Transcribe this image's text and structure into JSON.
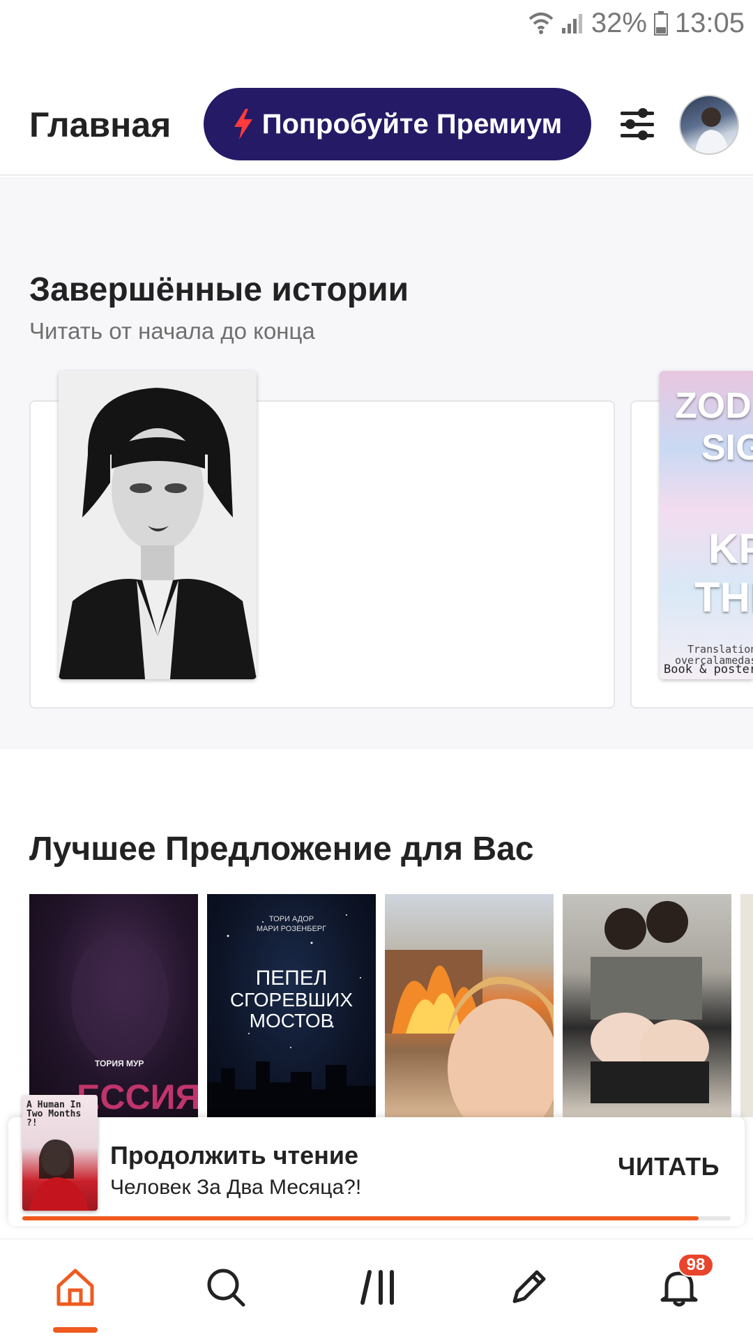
{
  "status_bar": {
    "battery": "32%",
    "time": "13:05"
  },
  "header": {
    "title": "Главная",
    "premium_label": "Попробуйте Премиум"
  },
  "completed_section": {
    "title": "Завершённые истории",
    "subtitle": "Читать от начала до конца",
    "cover_2_text": {
      "line1": "ZOD",
      "line2": "SIG",
      "line3": "KP",
      "line4": "THI",
      "small1": "Translationa",
      "small2": "overcalamedasi",
      "small3": "Book & poster by"
    }
  },
  "offer_section": {
    "title": "Лучшее Предложение для Вас",
    "covers": [
      {
        "author": "ТОРИЯ МУР",
        "title": "ЕССИЯ"
      },
      {
        "author_line1": "ТОРИ АДОР",
        "author_line2": "МАРИ РОЗЕНБЕРГ",
        "title_line1": "ПЕПЕЛ",
        "title_line2": "СГОРЕВШИХ",
        "title_line3": "МОСТОВ"
      },
      {},
      {}
    ]
  },
  "continue_reading": {
    "title": "Продолжить чтение",
    "book_title": "Человек За Два Месяца?!",
    "action_label": "ЧИТАТЬ",
    "cover_text": "A Human In Two Months ?!",
    "progress": 0.955
  },
  "bottom_nav": {
    "notifications_count": "98",
    "active": "home"
  },
  "colors": {
    "accent": "#ef5a1f",
    "premium_bg": "#241a66",
    "badge": "#e8452c"
  }
}
